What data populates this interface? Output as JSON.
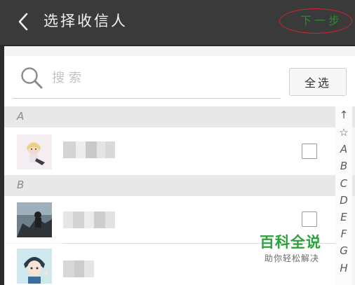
{
  "header": {
    "back_icon": "chevron-left-icon",
    "title": "选择收信人",
    "next_label": "下一步",
    "next_annotation_color": "#d6242b",
    "background": "#3a3a3a"
  },
  "search": {
    "icon": "search-icon",
    "placeholder": "搜索",
    "value": "",
    "select_all_label": "全选"
  },
  "sections": [
    {
      "letter": "A",
      "contacts": [
        {
          "avatar": "illustrated-girl-avatar",
          "checked": false
        }
      ]
    },
    {
      "letter": "B",
      "contacts": [
        {
          "avatar": "dark-figure-avatar",
          "checked": false
        },
        {
          "avatar": "anime-boy-avatar",
          "checked": false
        }
      ]
    }
  ],
  "index_bar": [
    "↑",
    "☆",
    "A",
    "B",
    "C",
    "D",
    "E",
    "F",
    "G",
    "H"
  ],
  "watermark": {
    "title": "百科全说",
    "subtitle": "助你轻松解决",
    "color": "#2aa43a"
  }
}
